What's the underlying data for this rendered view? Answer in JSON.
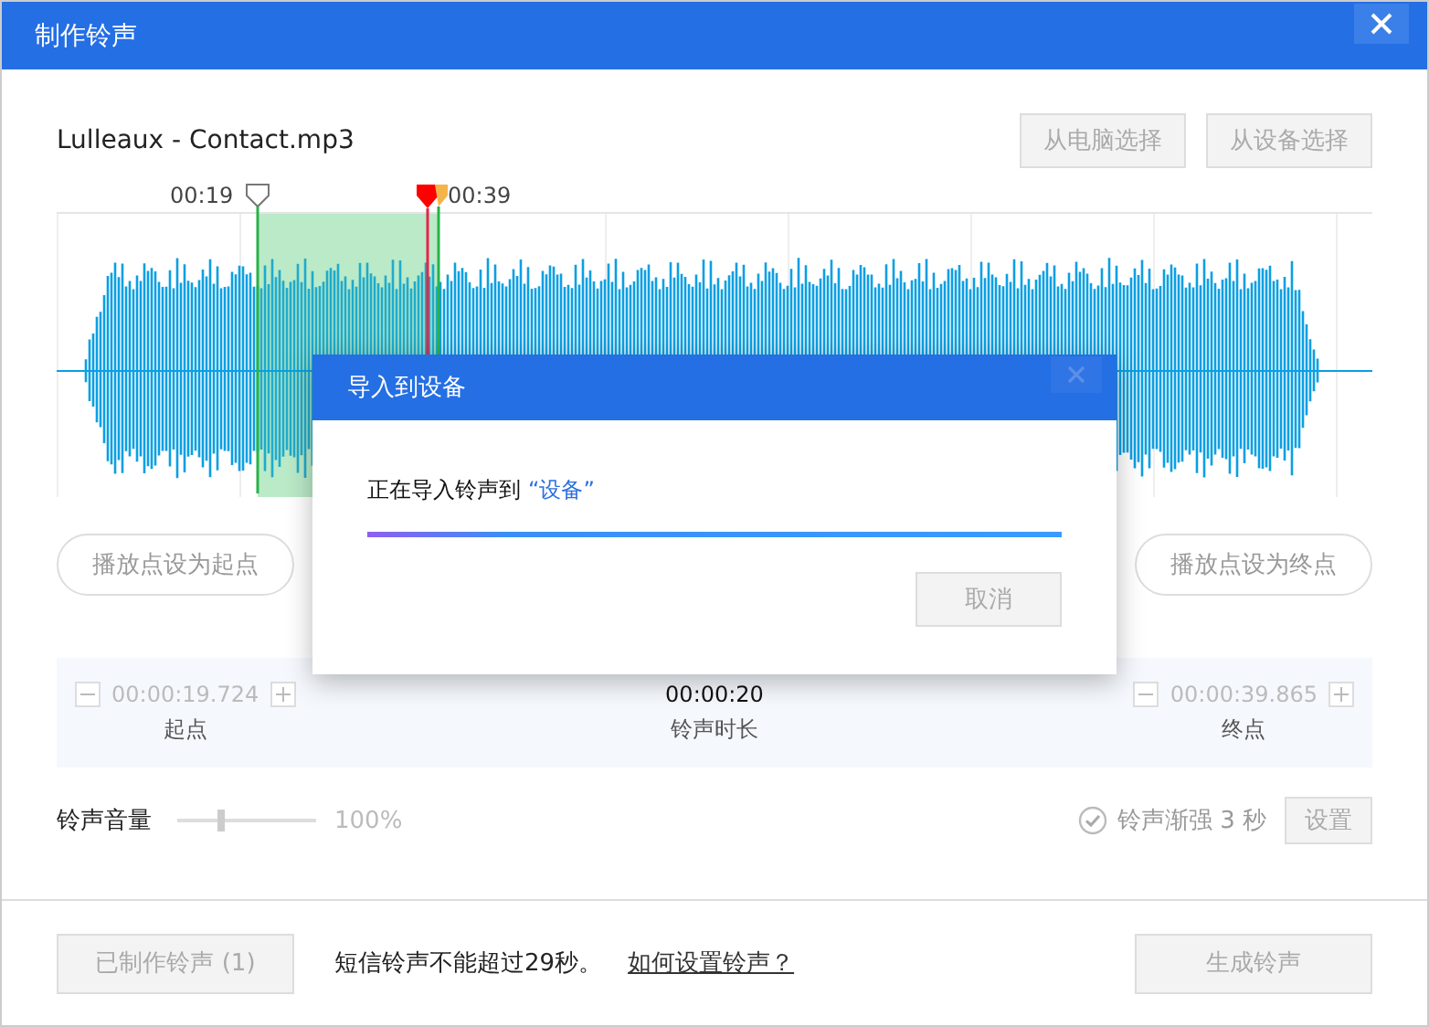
{
  "window": {
    "title": "制作铃声"
  },
  "file": {
    "name": "Lulleaux - Contact.mp3"
  },
  "source_buttons": [
    "从电脑选择",
    "从设备选择"
  ],
  "timeline": {
    "start_label": "00:19",
    "end_label": "00:39"
  },
  "set_buttons": [
    "播放点设为起点",
    "播放点设为终点"
  ],
  "range": {
    "start": {
      "value": "00:00:19.724",
      "label": "起点"
    },
    "duration": {
      "value": "00:00:20",
      "label": "铃声时长"
    },
    "end": {
      "value": "00:00:39.865",
      "label": "终点"
    }
  },
  "volume": {
    "label": "铃声音量",
    "level": 0.32,
    "reading": "100%"
  },
  "fade": {
    "label": "铃声渐强 3 秒",
    "checked": true,
    "button": "设置"
  },
  "footer": {
    "made_button": "已制作铃声 (1)",
    "note": "短信铃声不能超过29秒。",
    "help_link": "如何设置铃声？",
    "generate_button": "生成铃声"
  },
  "dialog": {
    "title": "导入到设备",
    "message": "正在导入铃声到",
    "target": "“设备”",
    "progress": {
      "level": 1
    },
    "cancel": "取消"
  }
}
